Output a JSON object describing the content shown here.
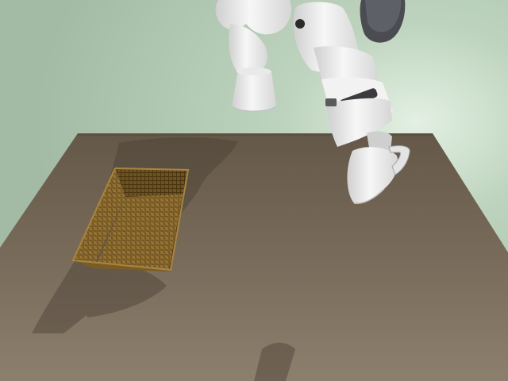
{
  "scene": {
    "objects": [
      {
        "name": "wall",
        "color": "#a9c4ab"
      },
      {
        "name": "table",
        "color": "#6e6253"
      },
      {
        "name": "wicker-basket",
        "color": "#8a6a2c"
      },
      {
        "name": "robot-arm",
        "color": "#ececec"
      },
      {
        "name": "robot-gripper",
        "color": "#ededed"
      }
    ]
  }
}
